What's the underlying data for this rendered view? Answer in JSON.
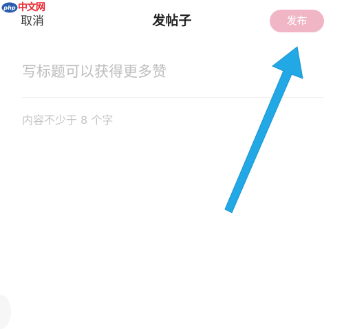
{
  "watermark": {
    "logo_text": "php",
    "site_text": "中文网"
  },
  "header": {
    "cancel_label": "取消",
    "title": "发帖子",
    "publish_label": "发布"
  },
  "editor": {
    "title_placeholder": "写标题可以获得更多赞",
    "content_placeholder": "内容不少于 8 个字"
  },
  "colors": {
    "publish_button_bg": "#f1b6c6",
    "annotation_arrow": "#22a8e4",
    "watermark_red": "#e9252e",
    "watermark_blue": "#2a5cae"
  },
  "annotation": {
    "icon": "arrow-icon"
  }
}
